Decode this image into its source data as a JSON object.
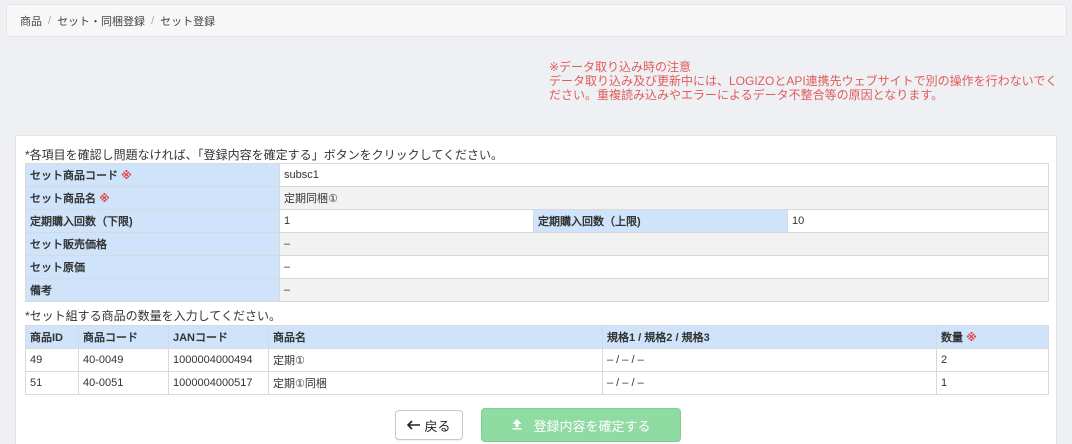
{
  "breadcrumb": {
    "items": [
      "商品",
      "セット・同梱登録",
      "セット登録"
    ],
    "separator": "/"
  },
  "notice": {
    "title": "※データ取り込み時の注意",
    "line1": "データ取り込み及び更新中には、LOGIZOとAPI連携先ウェブサイトで別の操作を行わないでく",
    "line2": "ださい。重複読み込みやエラーによるデータ不整合等の原因となります。"
  },
  "instruction_top": "*各項目を確認し問題なければ、「登録内容を確定する」ボタンをクリックしてください。",
  "form": {
    "set_code_label": "セット商品コード",
    "set_code_value": "subsc1",
    "set_name_label": "セット商品名",
    "set_name_value": "定期同梱①",
    "min_count_label": "定期購入回数（下限)",
    "min_count_value": "1",
    "max_count_label": "定期購入回数（上限)",
    "max_count_value": "10",
    "price_label": "セット販売価格",
    "price_value": "–",
    "cost_label": "セット原価",
    "cost_value": "–",
    "note_label": "備考",
    "note_value": "–",
    "required_mark": "※"
  },
  "instruction_items": "*セット組する商品の数量を入力してください。",
  "items_table": {
    "headers": {
      "id": "商品ID",
      "code": "商品コード",
      "jan": "JANコード",
      "name": "商品名",
      "spec": "規格1 / 規格2 / 規格3",
      "qty": "数量"
    },
    "rows": [
      {
        "id": "49",
        "code": "40-0049",
        "jan": "1000004000494",
        "name": "定期①",
        "spec": "– / – / –",
        "qty": "2"
      },
      {
        "id": "51",
        "code": "40-0051",
        "jan": "1000004000517",
        "name": "定期①同梱",
        "spec": "– / – / –",
        "qty": "1"
      }
    ]
  },
  "buttons": {
    "back": "戻る",
    "confirm": "登録内容を確定する"
  },
  "colors": {
    "label_bg": "#cfe4fb",
    "required": "#e0413f",
    "notice": "#e25b5b",
    "confirm_button": "#8fdba2"
  }
}
